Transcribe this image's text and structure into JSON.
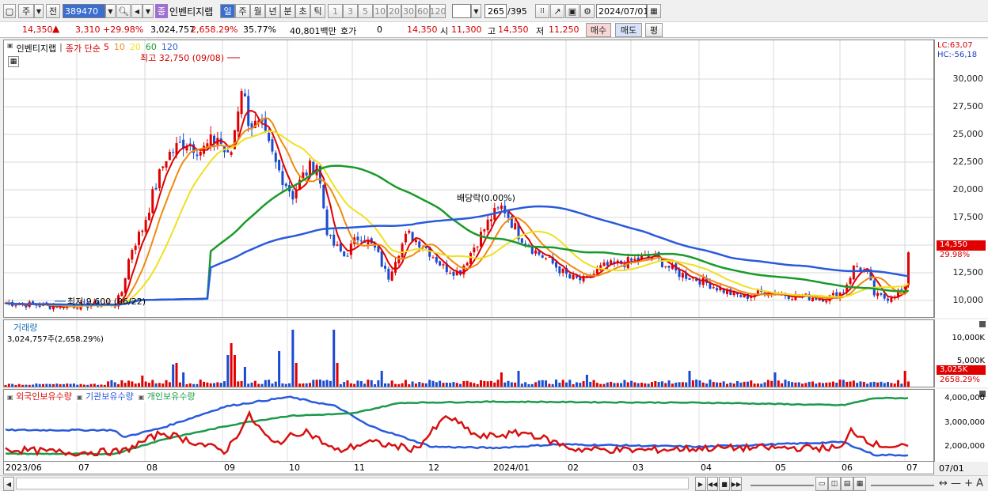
{
  "toolbar": {
    "market": "주",
    "prev_label": "전",
    "code": "389470",
    "stock_badge": "종",
    "stock_name": "인벤티지랩",
    "periods": [
      "일",
      "주",
      "월",
      "년",
      "분",
      "초",
      "틱"
    ],
    "intervals": [
      "1",
      "3",
      "5",
      "10",
      "20",
      "30",
      "60",
      "120"
    ],
    "count": "265",
    "count_total": "/395",
    "date": "2024/07/01"
  },
  "quote": {
    "price": "14,350",
    "change": "3,310",
    "change_pct": "+29.98%",
    "volume": "3,024,757",
    "volume_pct": "2,658.29%",
    "turnover": "35.77%",
    "amount": "40,801백만",
    "hoga_label": "호가",
    "hoga_value": "0",
    "hoga_price": "14,350",
    "open_label": "시",
    "open": "11,300",
    "high_label": "고",
    "high": "14,350",
    "low_label": "저",
    "low": "11,250",
    "buy_label": "매수",
    "sell_label": "매도",
    "eval_label": "평"
  },
  "price_panel": {
    "stock_name": "인벤티지랩",
    "legend_prefix": "종가 단순",
    "ma_labels": [
      "5",
      "10",
      "20",
      "60",
      "120"
    ],
    "ma_colors": [
      "#e00000",
      "#f08a10",
      "#f0e020",
      "#1a9a2a",
      "#2a5adc"
    ],
    "lc": "LC:63,07",
    "hc": "HC:-56,18",
    "high_annot": "최고 32,750 (09/08)",
    "low_annot": "최저 9,600 (06/22)",
    "div_annot": "배당락(0.00%)",
    "price_tag": "14,350",
    "pct_tag": "29.98%",
    "yticks": [
      "30,000",
      "27,500",
      "25,000",
      "22,500",
      "20,000",
      "17,500",
      "15,000",
      "12,500",
      "10,000"
    ]
  },
  "volume_panel": {
    "title": "거래량",
    "value_text": "3,024,757주(2,658.29%)",
    "yticks": [
      "10,000K",
      "5,000K"
    ],
    "tag1": "3,025K",
    "tag2": "2658.29%"
  },
  "holding_panel": {
    "legend": [
      "외국인보유수량",
      "기관보유수량",
      "개인보유수량"
    ],
    "legend_colors": [
      "#d81010",
      "#2a5adc",
      "#1a9a4a"
    ],
    "yticks": [
      "4,000,000",
      "3,000,000",
      "2,000,000"
    ]
  },
  "xaxis": {
    "labels": [
      "2023/06",
      "07",
      "08",
      "09",
      "10",
      "11",
      "12",
      "2024/01",
      "02",
      "03",
      "04",
      "05",
      "06",
      "07"
    ],
    "right_label": "07/01"
  },
  "chart_data": {
    "type": "candlestick",
    "period": "daily",
    "x_range": [
      "2023/06",
      "2024/07/01"
    ],
    "price_range": [
      9600,
      32750
    ],
    "high": {
      "value": 32750,
      "date": "09/08"
    },
    "low": {
      "value": 9600,
      "date": "06/22"
    },
    "last": {
      "close": 14350,
      "open": 11300,
      "high": 14350,
      "low": 11250,
      "change_pct": 29.98
    },
    "ma_periods": [
      5,
      10,
      20,
      60,
      120
    ]
  }
}
